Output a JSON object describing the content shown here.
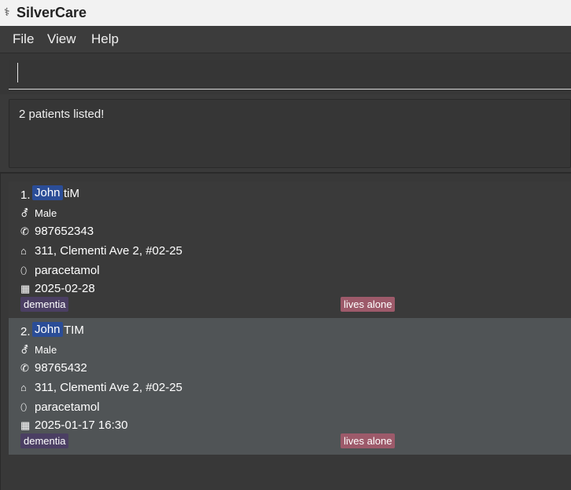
{
  "window": {
    "title": "SilverCare",
    "icon": "caduceus-icon"
  },
  "menu": {
    "file": "File",
    "view": "View",
    "help": "Help"
  },
  "command": {
    "value": "",
    "placeholder": ""
  },
  "result": {
    "message": "2 patients listed!"
  },
  "patients": [
    {
      "index": "1.",
      "first_name": "John",
      "last_name": "tiM",
      "gender": "Male",
      "phone": "987652343",
      "address": "311, Clementi Ave 2, #02-25",
      "medication": "paracetamol",
      "date": "2025-02-28",
      "tags": [
        "dementia",
        "lives alone"
      ]
    },
    {
      "index": "2.",
      "first_name": "John",
      "last_name": "TIM",
      "gender": "Male",
      "phone": "98765432",
      "address": "311, Clementi Ave 2, #02-25",
      "medication": "paracetamol",
      "date": "2025-01-17 16:30",
      "tags": [
        "dementia",
        "lives alone"
      ]
    }
  ],
  "icons": {
    "gender": "gender-icon",
    "phone": "phone-icon",
    "address": "home-icon",
    "medication": "pill-icon",
    "date": "calendar-icon"
  },
  "colors": {
    "highlight": "#2b4d97",
    "tag_dementia": "#4b3f63",
    "tag_lives_alone": "#9d5a6a",
    "selected_row": "#505456"
  }
}
